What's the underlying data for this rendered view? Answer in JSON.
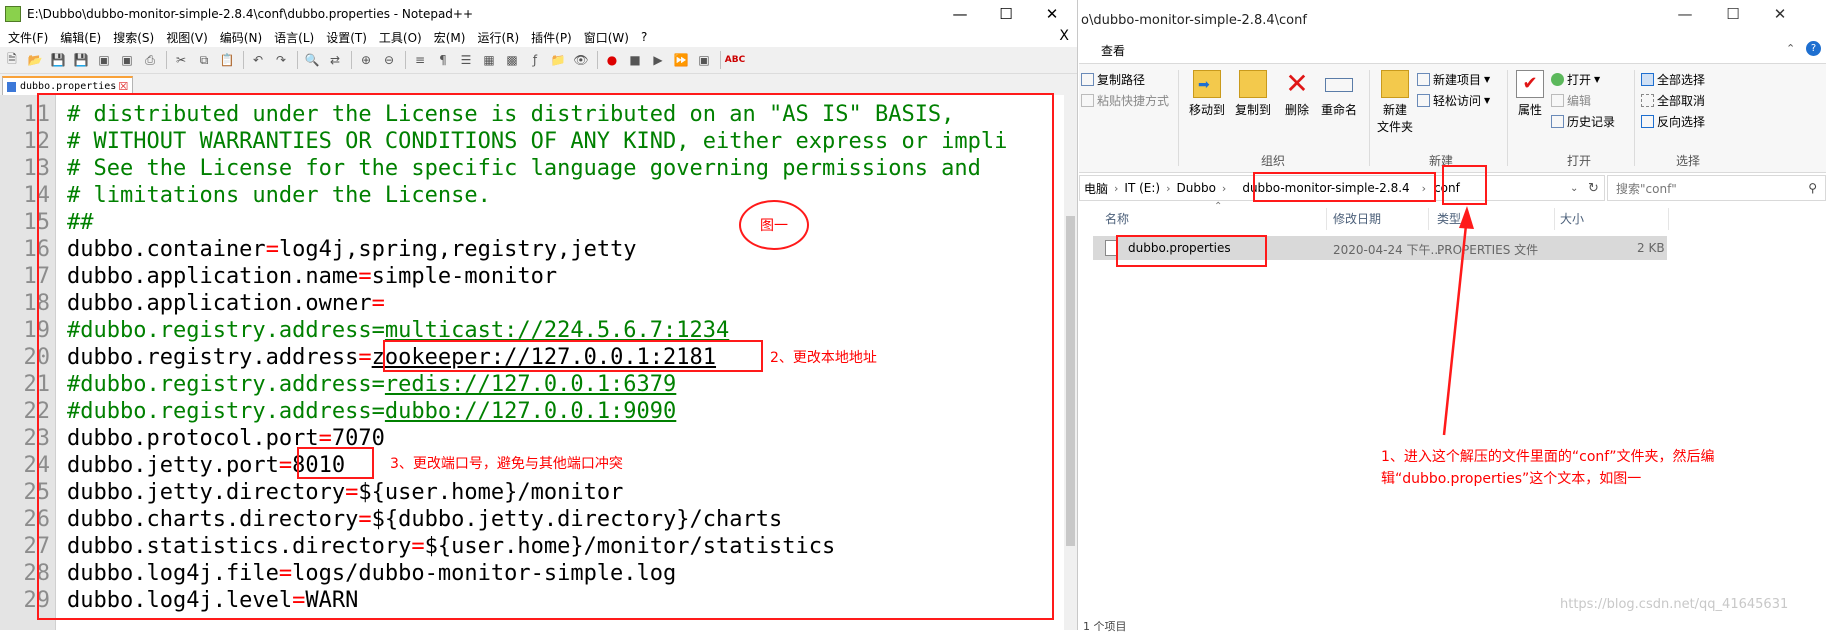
{
  "notepad": {
    "title": "E:\\Dubbo\\dubbo-monitor-simple-2.8.4\\conf\\dubbo.properties - Notepad++",
    "menu": [
      "文件(F)",
      "编辑(E)",
      "搜索(S)",
      "视图(V)",
      "编码(N)",
      "语言(L)",
      "设置(T)",
      "工具(O)",
      "宏(M)",
      "运行(R)",
      "插件(P)",
      "窗口(W)",
      "?"
    ],
    "menu_close": "X",
    "tab_label": "dubbo.properties",
    "lines": [
      {
        "num": "11",
        "text": "# distributed under the License is distributed on an \"AS IS\" BASIS,",
        "kind": "comment"
      },
      {
        "num": "12",
        "text": "# WITHOUT WARRANTIES OR CONDITIONS OF ANY KIND, either express or impli",
        "kind": "comment"
      },
      {
        "num": "13",
        "text": "# See the License for the specific language governing permissions and",
        "kind": "comment"
      },
      {
        "num": "14",
        "text": "# limitations under the License.",
        "kind": "comment"
      },
      {
        "num": "15",
        "text": "##",
        "kind": "comment"
      },
      {
        "num": "16",
        "key": "dubbo.container",
        "value": "log4j,spring,registry,jetty",
        "kind": "kv"
      },
      {
        "num": "17",
        "key": "dubbo.application.name",
        "value": "simple-monitor",
        "kind": "kv"
      },
      {
        "num": "18",
        "key": "dubbo.application.owner",
        "value": "",
        "kind": "kv"
      },
      {
        "num": "19",
        "key": "#dubbo.registry.address",
        "value": "multicast://224.5.6.7:1234",
        "kind": "ckv"
      },
      {
        "num": "20",
        "key": "dubbo.registry.address",
        "value": "zookeeper://127.0.0.1:2181",
        "kind": "kv_url"
      },
      {
        "num": "21",
        "key": "#dubbo.registry.address",
        "value": "redis://127.0.0.1:6379",
        "kind": "ckv"
      },
      {
        "num": "22",
        "key": "#dubbo.registry.address",
        "value": "dubbo://127.0.0.1:9090",
        "kind": "ckv"
      },
      {
        "num": "23",
        "key": "dubbo.protocol.port",
        "value": "7070",
        "kind": "kv"
      },
      {
        "num": "24",
        "key": "dubbo.jetty.port",
        "value": "8010",
        "kind": "kv"
      },
      {
        "num": "25",
        "key": "dubbo.jetty.directory",
        "value": "${user.home}/monitor",
        "kind": "kv"
      },
      {
        "num": "26",
        "key": "dubbo.charts.directory",
        "value": "${dubbo.jetty.directory}/charts",
        "kind": "kv"
      },
      {
        "num": "27",
        "key": "dubbo.statistics.directory",
        "value": "${user.home}/monitor/statistics",
        "kind": "kv"
      },
      {
        "num": "28",
        "key": "dubbo.log4j.file",
        "value": "logs/dubbo-monitor-simple.log",
        "kind": "kv"
      },
      {
        "num": "29",
        "key": "dubbo.log4j.level",
        "value": "WARN",
        "kind": "kv"
      }
    ],
    "scroll_fraction": 0.62
  },
  "explorer": {
    "title": "o\\dubbo-monitor-simple-2.8.4\\conf",
    "ribbon_tab": "查看",
    "clipboard": {
      "copy_path": "复制路径",
      "paste_shortcut": "粘贴快捷方式"
    },
    "organize": {
      "move_to": "移动到",
      "copy_to": "复制到",
      "delete": "删除",
      "rename": "重命名",
      "label": "组织"
    },
    "new": {
      "new_folder_line1": "新建",
      "new_folder_line2": "文件夹",
      "new_item": "新建项目",
      "easy_access": "轻松访问",
      "label": "新建"
    },
    "open": {
      "properties": "属性",
      "open": "打开",
      "edit": "编辑",
      "history": "历史记录",
      "label": "打开"
    },
    "select": {
      "select_all": "全部选择",
      "select_none": "全部取消",
      "invert": "反向选择",
      "label": "选择"
    },
    "breadcrumbs": [
      "电脑",
      "IT (E:)",
      "Dubbo",
      "dubbo-monitor-simple-2.8.4",
      "conf"
    ],
    "search_placeholder": "搜索\"conf\"",
    "columns": {
      "name": "名称",
      "modified": "修改日期",
      "type": "类型",
      "size": "大小"
    },
    "file": {
      "name": "dubbo.properties",
      "modified": "2020-04-24 下午...",
      "type": "PROPERTIES 文件",
      "size": "2 KB"
    },
    "bottom_text": "1 个项目"
  },
  "annotations": {
    "fig_label": "图一",
    "step1": [
      "1、进入这个解压的文件里面的“conf”文件夹，然后编",
      "辑“dubbo.properties”这个文本，如图一"
    ],
    "step2": "2、更改本地地址",
    "step3": "3、更改端口号，避免与其他端口冲突",
    "accent_color": "#ff1a1a"
  },
  "watermark": "https://blog.csdn.net/qq_41645631"
}
